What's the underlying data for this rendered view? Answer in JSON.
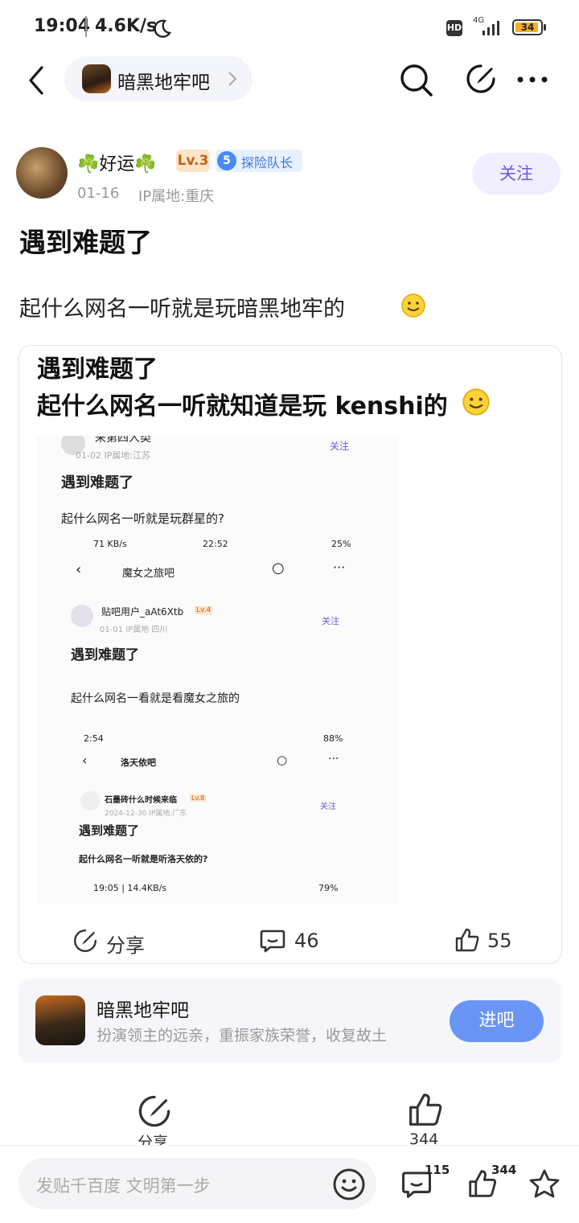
{
  "status_bar": {
    "time": "19:04",
    "speed": "4.6K/s",
    "network": "4G",
    "hd": "HD",
    "battery": "34"
  },
  "nav": {
    "forum_name": "暗黑地牢吧"
  },
  "author": {
    "name": "☘️好运☘️",
    "level": "Lv.3",
    "badge_num": "5",
    "badge_text": "探险队长",
    "date": "01-16",
    "ip": "IP属地:重庆",
    "follow_label": "关注"
  },
  "post": {
    "title": "遇到难题了",
    "body": "起什么网名一听就是玩暗黑地牢的"
  },
  "image": {
    "line1": "遇到难题了",
    "line2": "起什么网名一听就知道是玩 kenshi的",
    "nested1": {
      "user": "采第四人类",
      "date_ip": "01-02  IP属地:江苏",
      "follow": "关注",
      "title": "遇到难题了",
      "body": "起什么网名一听就是玩群星的?"
    },
    "nested2": {
      "status_left": "71 KB/s",
      "status_time": "22:52",
      "status_right": "25%",
      "forum": "魔女之旅吧",
      "user": "贴吧用户_aAt6Xtb",
      "level": "Lv.4",
      "date_ip": "01-01  IP属地 四川",
      "follow": "关注",
      "title": "遇到难题了",
      "body": "起什么网名一看就是看魔女之旅的"
    },
    "nested3": {
      "status_time": "2:54",
      "status_right": "88%",
      "forum": "洛天依吧",
      "user": "石墨砖什么时候来临",
      "level": "Lv.8",
      "date_ip": "2024-12-30  IP属地:广东",
      "follow": "关注",
      "title": "遇到难题了",
      "body": "起什么网名一听就是听洛天依的?"
    },
    "nested4": {
      "status_left": "19:05 | 14.4KB/s",
      "status_right": "79%"
    },
    "actions": {
      "share": "分享",
      "comments": "46",
      "likes": "55"
    }
  },
  "forum_card": {
    "name": "暗黑地牢吧",
    "desc": "扮演领主的远亲，重振家族荣誉，收复故土",
    "enter_label": "进吧"
  },
  "bottom_actions": {
    "share_label": "分享",
    "like_count": "344"
  },
  "bottom_bar": {
    "placeholder": "发贴千百度 文明第一步",
    "comment_count": "115",
    "like_count": "344"
  },
  "colors": {
    "accent": "#6a95f6",
    "follow_text": "#6a5ae0",
    "level_bg": "#fde3c8",
    "badge_blue": "#4a8af5"
  }
}
